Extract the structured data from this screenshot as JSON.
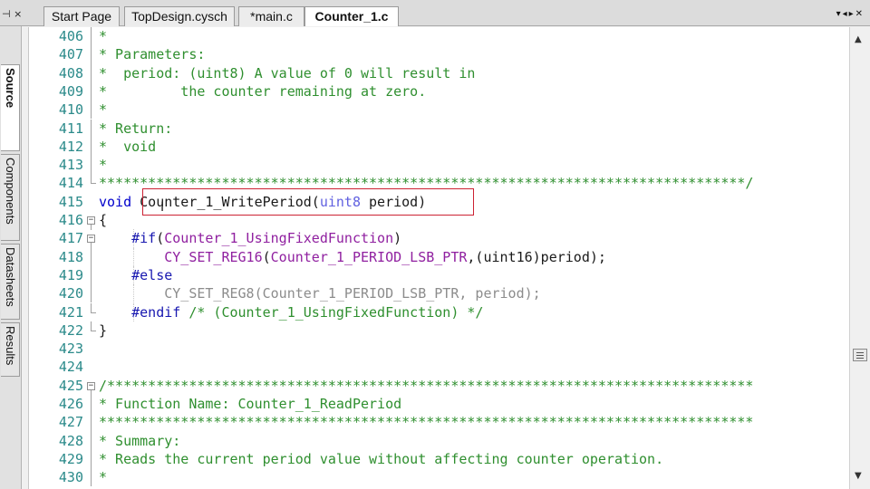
{
  "tabs": [
    {
      "label": "Start Page",
      "active": false
    },
    {
      "label": "TopDesign.cysch",
      "active": false
    },
    {
      "label": "*main.c",
      "active": false
    },
    {
      "label": "Counter_1.c",
      "active": true
    }
  ],
  "side_tabs": [
    {
      "label": "Source",
      "active": true
    },
    {
      "label": "Components",
      "active": false
    },
    {
      "label": "Datasheets",
      "active": false
    },
    {
      "label": "Results",
      "active": false
    }
  ],
  "colors": {
    "comment": "#2f8f2f",
    "keyword": "#0000cc",
    "type": "#6060e0",
    "macro": "#9020a0",
    "line_number": "#2b8a8a",
    "highlight_box": "#cc2233"
  },
  "code": [
    {
      "num": "406",
      "fold": "line",
      "segments": [
        {
          "cls": "c",
          "text": "*"
        }
      ]
    },
    {
      "num": "407",
      "fold": "line",
      "segments": [
        {
          "cls": "c",
          "text": "* Parameters:"
        }
      ]
    },
    {
      "num": "408",
      "fold": "line",
      "segments": [
        {
          "cls": "c",
          "text": "*  period: (uint8) A value of 0 will result in"
        }
      ]
    },
    {
      "num": "409",
      "fold": "line",
      "segments": [
        {
          "cls": "c",
          "text": "*         the counter remaining at zero."
        }
      ]
    },
    {
      "num": "410",
      "fold": "line",
      "segments": [
        {
          "cls": "c",
          "text": "*"
        }
      ]
    },
    {
      "num": "411",
      "fold": "line",
      "segments": [
        {
          "cls": "c",
          "text": "* Return:"
        }
      ]
    },
    {
      "num": "412",
      "fold": "line",
      "segments": [
        {
          "cls": "c",
          "text": "*  void"
        }
      ]
    },
    {
      "num": "413",
      "fold": "line",
      "segments": [
        {
          "cls": "c",
          "text": "*"
        }
      ]
    },
    {
      "num": "414",
      "fold": "end",
      "segments": [
        {
          "cls": "c",
          "text": "*******************************************************************************/"
        }
      ]
    },
    {
      "num": "415",
      "fold": "none",
      "segments": [
        {
          "cls": "k",
          "text": "void"
        },
        {
          "cls": "d",
          "text": " Counter_1_WritePeriod("
        },
        {
          "cls": "t",
          "text": "uint8"
        },
        {
          "cls": "d",
          "text": " period)"
        }
      ]
    },
    {
      "num": "416",
      "fold": "box",
      "segments": [
        {
          "cls": "d",
          "text": "{"
        }
      ]
    },
    {
      "num": "417",
      "fold": "box",
      "guides": [
        1
      ],
      "segments": [
        {
          "cls": "d",
          "text": "    "
        },
        {
          "cls": "p",
          "text": "#if"
        },
        {
          "cls": "d",
          "text": "("
        },
        {
          "cls": "m",
          "text": "Counter_1_UsingFixedFunction"
        },
        {
          "cls": "d",
          "text": ")"
        }
      ]
    },
    {
      "num": "418",
      "fold": "line",
      "guides": [
        1
      ],
      "segments": [
        {
          "cls": "d",
          "text": "        "
        },
        {
          "cls": "m",
          "text": "CY_SET_REG16"
        },
        {
          "cls": "d",
          "text": "("
        },
        {
          "cls": "m",
          "text": "Counter_1_PERIOD_LSB_PTR"
        },
        {
          "cls": "d",
          "text": ",(uint16)period);"
        }
      ]
    },
    {
      "num": "419",
      "fold": "line",
      "guides": [
        1
      ],
      "segments": [
        {
          "cls": "d",
          "text": "    "
        },
        {
          "cls": "p",
          "text": "#else"
        }
      ]
    },
    {
      "num": "420",
      "fold": "line",
      "guides": [
        1
      ],
      "segments": [
        {
          "cls": "d",
          "text": "        "
        },
        {
          "cls": "g",
          "text": "CY_SET_REG8(Counter_1_PERIOD_LSB_PTR, period);"
        }
      ]
    },
    {
      "num": "421",
      "fold": "end",
      "guides": [
        1
      ],
      "segments": [
        {
          "cls": "d",
          "text": "    "
        },
        {
          "cls": "p",
          "text": "#endif"
        },
        {
          "cls": "d",
          "text": " "
        },
        {
          "cls": "c",
          "text": "/* (Counter_1_UsingFixedFunction) */"
        }
      ]
    },
    {
      "num": "422",
      "fold": "end",
      "segments": [
        {
          "cls": "d",
          "text": "}"
        }
      ]
    },
    {
      "num": "423",
      "fold": "none",
      "segments": []
    },
    {
      "num": "424",
      "fold": "none",
      "segments": []
    },
    {
      "num": "425",
      "fold": "box",
      "segments": [
        {
          "cls": "c",
          "text": "/*******************************************************************************"
        }
      ]
    },
    {
      "num": "426",
      "fold": "line",
      "segments": [
        {
          "cls": "c",
          "text": "* Function Name: Counter_1_ReadPeriod"
        }
      ]
    },
    {
      "num": "427",
      "fold": "line",
      "segments": [
        {
          "cls": "c",
          "text": "********************************************************************************"
        }
      ]
    },
    {
      "num": "428",
      "fold": "line",
      "segments": [
        {
          "cls": "c",
          "text": "* Summary:"
        }
      ]
    },
    {
      "num": "429",
      "fold": "line",
      "segments": [
        {
          "cls": "c",
          "text": "* Reads the current period value without affecting counter operation."
        }
      ]
    },
    {
      "num": "430",
      "fold": "line",
      "segments": [
        {
          "cls": "c",
          "text": "*"
        }
      ]
    }
  ]
}
